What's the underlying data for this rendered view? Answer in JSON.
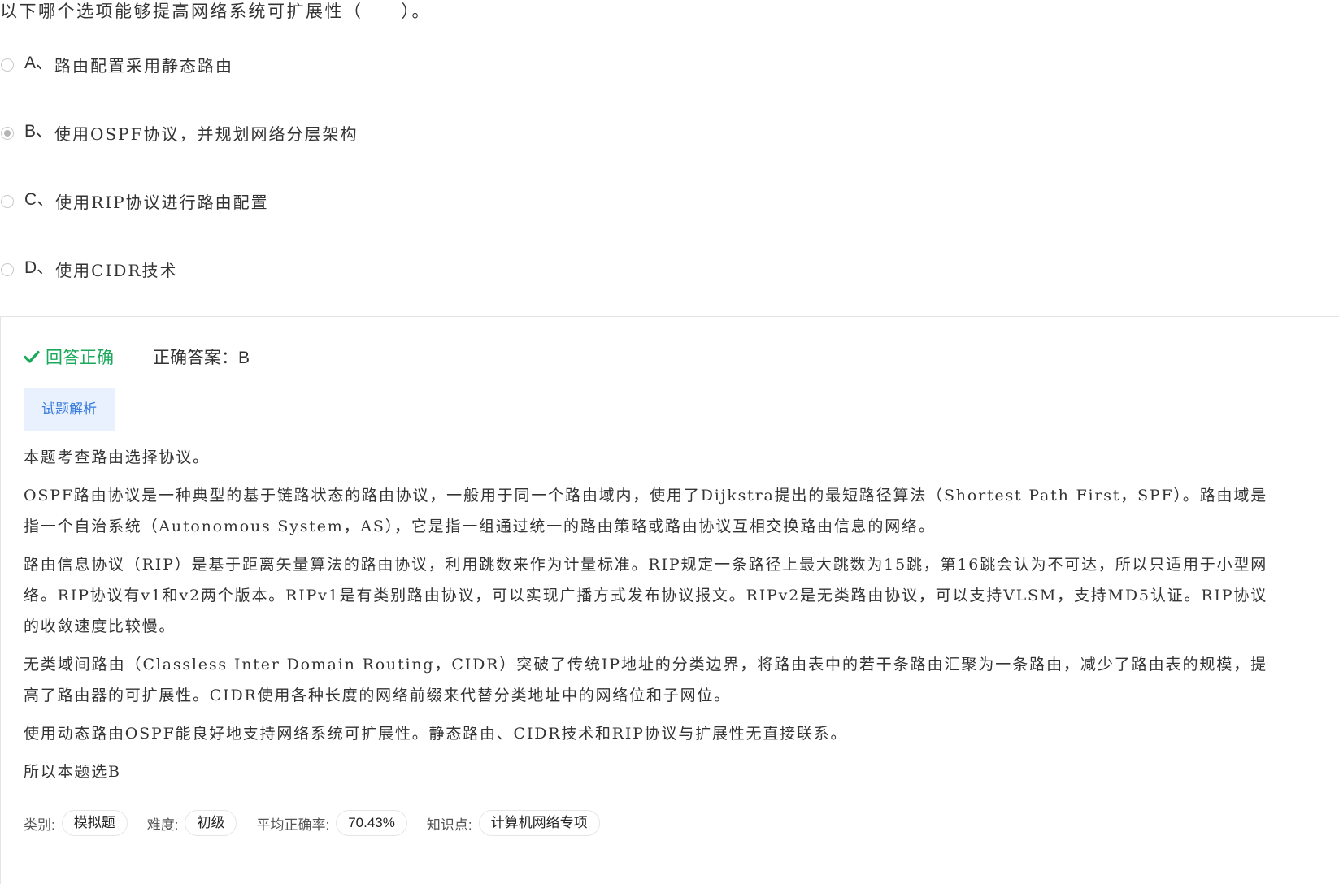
{
  "question": {
    "text": "以下哪个选项能够提高网络系统可扩展性（　　）。"
  },
  "options": [
    {
      "letter": "A、",
      "text": "路由配置采用静态路由",
      "selected": false
    },
    {
      "letter": "B、",
      "text": "使用OSPF协议，并规划网络分层架构",
      "selected": true
    },
    {
      "letter": "C、",
      "text": "使用RIP协议进行路由配置",
      "selected": false
    },
    {
      "letter": "D、",
      "text": "使用CIDR技术",
      "selected": false
    }
  ],
  "result": {
    "status": "回答正确",
    "answer": "正确答案：B",
    "status_color": "#1aa95b"
  },
  "analysis_tab": {
    "label": "试题解析"
  },
  "analysis": {
    "paragraphs": [
      "本题考查路由选择协议。",
      "OSPF路由协议是一种典型的基于链路状态的路由协议，一般用于同一个路由域内，使用了Dijkstra提出的最短路径算法（Shortest Path First，SPF）。路由域是指一个自治系统（Autonomous System，AS），它是指一组通过统一的路由策略或路由协议互相交换路由信息的网络。",
      "路由信息协议（RIP）是基于距离矢量算法的路由协议，利用跳数来作为计量标准。RIP规定一条路径上最大跳数为15跳，第16跳会认为不可达，所以只适用于小型网络。RIP协议有v1和v2两个版本。RIPv1是有类别路由协议，可以实现广播方式发布协议报文。RIPv2是无类路由协议，可以支持VLSM，支持MD5认证。RIP协议的收敛速度比较慢。",
      "无类域间路由（Classless Inter Domain Routing，CIDR）突破了传统IP地址的分类边界，将路由表中的若干条路由汇聚为一条路由，减少了路由表的规模，提高了路由器的可扩展性。CIDR使用各种长度的网络前缀来代替分类地址中的网络位和子网位。",
      "使用动态路由OSPF能良好地支持网络系统可扩展性。静态路由、CIDR技术和RIP协议与扩展性无直接联系。",
      "所以本题选B"
    ]
  },
  "meta": {
    "category_label": "类别:",
    "category_value": "模拟题",
    "difficulty_label": "难度:",
    "difficulty_value": "初级",
    "accuracy_label": "平均正确率:",
    "accuracy_value": "70.43%",
    "knowledge_label": "知识点:",
    "knowledge_value": "计算机网络专项"
  },
  "icons": {
    "check": "check-icon"
  }
}
